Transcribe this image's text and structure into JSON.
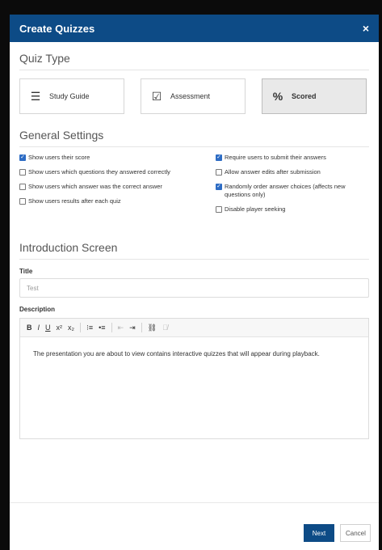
{
  "modal": {
    "title": "Create Quizzes",
    "close_icon": "×",
    "accent": "#0d4b86"
  },
  "quiz_type": {
    "heading": "Quiz Type",
    "options": [
      {
        "label": "Study Guide",
        "icon": "list-icon",
        "glyph": "☰",
        "selected": false
      },
      {
        "label": "Assessment",
        "icon": "checkbox-pencil-icon",
        "glyph": "☑",
        "selected": false
      },
      {
        "label": "Scored",
        "icon": "percent-icon",
        "glyph": "%",
        "selected": true
      }
    ]
  },
  "general_settings": {
    "heading": "General Settings",
    "left": [
      {
        "label": "Show users their score",
        "checked": true
      },
      {
        "label": "Show users which questions they answered correctly",
        "checked": false
      },
      {
        "label": "Show users which answer was the correct answer",
        "checked": false
      },
      {
        "label": "Show users results after each quiz",
        "checked": false
      }
    ],
    "right": [
      {
        "label": "Require users to submit their answers",
        "checked": true
      },
      {
        "label": "Allow answer edits after submission",
        "checked": false
      },
      {
        "label": "Randomly order answer choices (affects new questions only)",
        "checked": true
      },
      {
        "label": "Disable player seeking",
        "checked": false
      }
    ]
  },
  "intro_screen": {
    "heading": "Introduction Screen",
    "title_label": "Title",
    "title_value": "Test",
    "description_label": "Description",
    "toolbar": {
      "bold": "B",
      "italic": "I",
      "underline": "U",
      "superscript": "x²",
      "subscript": "x₂",
      "ordered_list": "⁝≡",
      "unordered_list": "•≡",
      "outdent": "⇤",
      "indent": "⇥",
      "link": "⛓",
      "unlink": "⛓̸"
    },
    "description_text": "The presentation you are about to view contains interactive quizzes that will appear during playback."
  },
  "footer": {
    "next": "Next",
    "cancel": "Cancel"
  }
}
